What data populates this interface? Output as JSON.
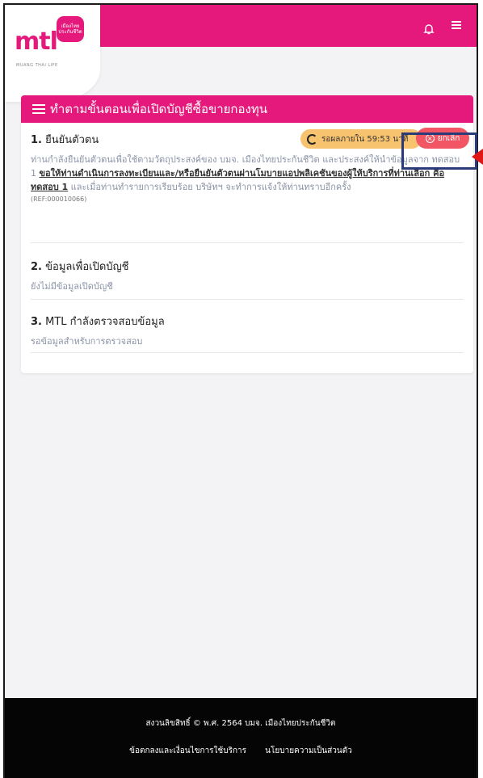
{
  "header": {
    "logo_text": "mtl",
    "logo_badge": "เมืองไทยประกันชีวิต",
    "logo_sub": "MUANG THAI LIFE",
    "bell_icon": "bell-icon",
    "menu_icon": "hamburger-menu-icon",
    "brand_color": "#e5197b"
  },
  "card": {
    "title": "ทำตามขั้นตอนเพื่อเปิดบัญชีซื้อขายกองทุน",
    "steps": [
      {
        "number": "1.",
        "title": "ยืนยันตัวตน",
        "desc_part1": "ท่านกำลังยืนยันตัวตนเพื่อใช้ตามวัตถุประสงค์ของ บมจ. เมืองไทยประกันชีวิต และประสงค์ให้นำข้อมูลจาก ทดสอบ 1 ",
        "desc_underlined": "ขอให้ท่านดำเนินการลงทะเบียนและ/หรือยืนยันตัวตนผ่านโมบายแอปพลิเคชันของผู้ให้บริการที่ท่านเลือก คือ ทดสอบ 1",
        "desc_part2": " และเมื่อท่านทำรายการเรียบร้อย บริษัทฯ จะทำการแจ้งให้ท่านทราบอีกครั้ง",
        "ref": "(REF:000010066)",
        "pending_label": "รอผลภายใน 59:53 นาที",
        "cancel_label": "ยกเลิก"
      },
      {
        "number": "2.",
        "title": "ข้อมูลเพื่อเปิดบัญชี",
        "desc": "ยังไม่มีข้อมูลเปิดบัญชี"
      },
      {
        "number": "3.",
        "title": "MTL กำลังตรวจสอบข้อมูล",
        "desc": "รอข้อมูลสำหรับการตรวจสอบ"
      }
    ]
  },
  "footer": {
    "copyright": "สงวนลิขสิทธิ์ © พ.ศ. 2564 บมจ. เมืองไทยประกันชีวิต",
    "links": [
      "ข้อตกลงและเงื่อนไขการใช้บริการ",
      "นโยบายความเป็นส่วนตัว"
    ]
  }
}
